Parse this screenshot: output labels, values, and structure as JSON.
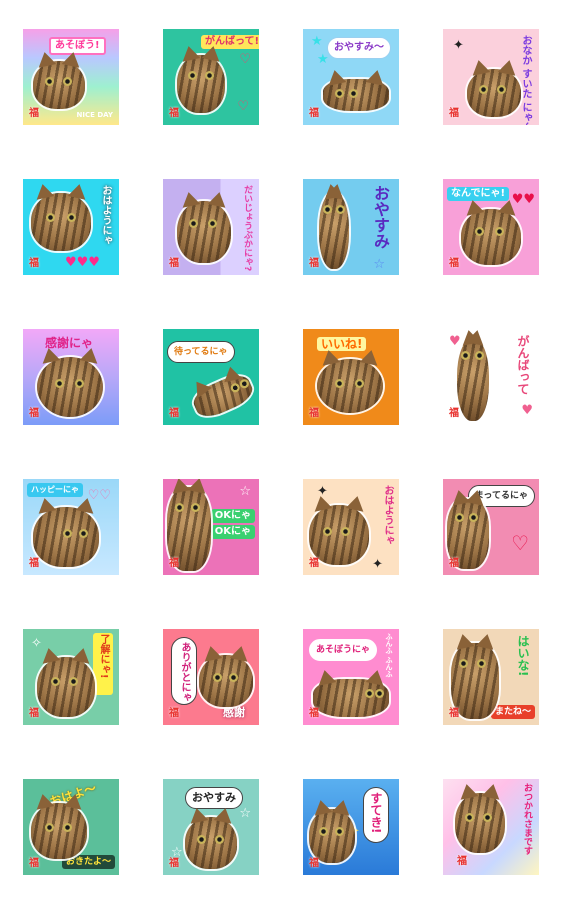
{
  "mark": "福",
  "stickers": [
    {
      "caption": "あそぼう!",
      "extra": "NICE DAY"
    },
    {
      "caption": "がんばって!"
    },
    {
      "caption": "おやすみ〜"
    },
    {
      "caption": "おなか すいた にゃ〜"
    },
    {
      "caption": "おはようにゃ"
    },
    {
      "caption": "だいじょうぶかにゃ?"
    },
    {
      "caption": "おやすみ"
    },
    {
      "caption": "なんでにゃ!"
    },
    {
      "caption": "感謝にゃ"
    },
    {
      "caption": "待ってるにゃ"
    },
    {
      "caption": "いいね!"
    },
    {
      "caption": "がんばって"
    },
    {
      "caption": "ハッピーにゃ"
    },
    {
      "caption": "OKにゃ",
      "extra": "OKにゃ"
    },
    {
      "caption": "おはようにゃ"
    },
    {
      "caption": "まってるにゃ"
    },
    {
      "caption": "了解にゃ!"
    },
    {
      "caption": "ありがとにゃ",
      "extra": "感謝"
    },
    {
      "caption": "あそぼうにゃ",
      "extra": "ふんふ ふんふ"
    },
    {
      "caption": "はいな!",
      "extra": "またね〜"
    },
    {
      "caption": "おはよ〜",
      "extra": "おきたよ〜"
    },
    {
      "caption": "おやすみ"
    },
    {
      "caption": "すてき!"
    },
    {
      "caption": "おつかれさまです"
    }
  ]
}
